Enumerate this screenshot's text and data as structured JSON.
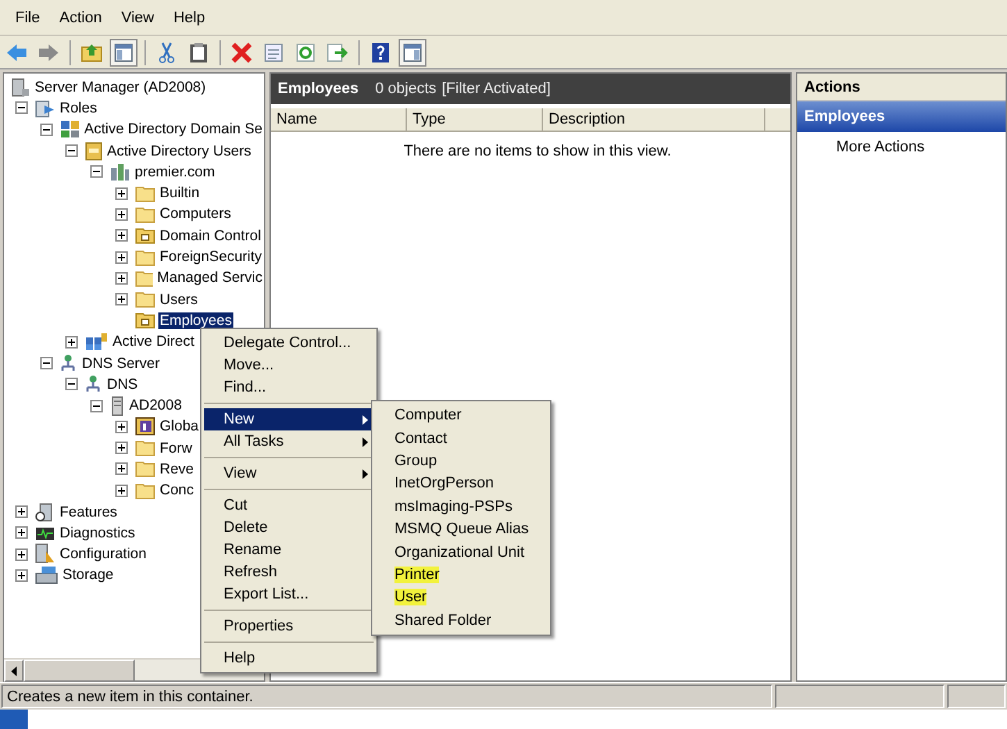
{
  "menu_bar": [
    "File",
    "Action",
    "View",
    "Help"
  ],
  "toolbar": [
    {
      "kind": "back"
    },
    {
      "kind": "forward"
    },
    {
      "kind": "sep"
    },
    {
      "kind": "up"
    },
    {
      "kind": "tree",
      "selected": true
    },
    {
      "kind": "sep"
    },
    {
      "kind": "cut"
    },
    {
      "kind": "paste"
    },
    {
      "kind": "sep"
    },
    {
      "kind": "delete"
    },
    {
      "kind": "properties"
    },
    {
      "kind": "refresh"
    },
    {
      "kind": "export"
    },
    {
      "kind": "sep"
    },
    {
      "kind": "help"
    },
    {
      "kind": "actionpane",
      "selected": true
    }
  ],
  "tree": [
    {
      "label": "Server Manager (AD2008)",
      "kind": "server",
      "selected": false,
      "children": [
        {
          "label": "Roles",
          "kind": "roles",
          "expanded": true,
          "selected": false,
          "children": [
            {
              "label": "Active Directory Domain Se",
              "kind": "ad",
              "expanded": true,
              "selected": false,
              "children": [
                {
                  "label": "Active Directory Users",
                  "kind": "book",
                  "expanded": true,
                  "selected": false,
                  "children": [
                    {
                      "label": "premier.com",
                      "kind": "domain",
                      "expanded": true,
                      "selected": false,
                      "children": [
                        {
                          "label": "Builtin",
                          "kind": "folder",
                          "expanded": false,
                          "selected": false
                        },
                        {
                          "label": "Computers",
                          "kind": "folder",
                          "expanded": false,
                          "selected": false
                        },
                        {
                          "label": "Domain Control",
                          "kind": "ou",
                          "expanded": false,
                          "selected": false
                        },
                        {
                          "label": "ForeignSecurity",
                          "kind": "folder",
                          "expanded": false,
                          "selected": false
                        },
                        {
                          "label": "Managed Servic",
                          "kind": "folder",
                          "expanded": false,
                          "selected": false
                        },
                        {
                          "label": "Users",
                          "kind": "folder",
                          "expanded": false,
                          "selected": false
                        },
                        {
                          "label": "Employees",
                          "kind": "ou",
                          "selected": true
                        }
                      ]
                    }
                  ]
                },
                {
                  "label": "Active Direct",
                  "kind": "sites",
                  "expanded": false,
                  "selected": false
                }
              ]
            },
            {
              "label": "DNS Server",
              "kind": "dns",
              "expanded": true,
              "selected": false,
              "children": [
                {
                  "label": "DNS",
                  "kind": "dns",
                  "expanded": true,
                  "selected": false,
                  "children": [
                    {
                      "label": "AD2008",
                      "kind": "computer",
                      "expanded": true,
                      "selected": false,
                      "children": [
                        {
                          "label": "Globa",
                          "kind": "log",
                          "expanded": false,
                          "selected": false
                        },
                        {
                          "label": "Forw",
                          "kind": "folder",
                          "expanded": false,
                          "selected": false
                        },
                        {
                          "label": "Reve",
                          "kind": "folder",
                          "expanded": false,
                          "selected": false
                        },
                        {
                          "label": "Conc",
                          "kind": "folder",
                          "expanded": false,
                          "selected": false
                        }
                      ]
                    }
                  ]
                }
              ]
            }
          ]
        },
        {
          "label": "Features",
          "kind": "features",
          "expanded": false,
          "selected": false
        },
        {
          "label": "Diagnostics",
          "kind": "diagnostics",
          "expanded": false,
          "selected": false
        },
        {
          "label": "Configuration",
          "kind": "config",
          "expanded": false,
          "selected": false
        },
        {
          "label": "Storage",
          "kind": "storage",
          "expanded": false,
          "selected": false
        }
      ]
    }
  ],
  "content": {
    "title": "Employees",
    "count": "0 objects",
    "filter": "[Filter Activated]",
    "columns": [
      "Name",
      "Type",
      "Description"
    ],
    "empty_message": "There are no items to show in this view."
  },
  "actions": {
    "title": "Actions",
    "section": "Employees",
    "items": [
      "More Actions"
    ]
  },
  "context_menu": [
    {
      "kind": "item",
      "label": "Delegate Control...",
      "selected": false
    },
    {
      "kind": "item",
      "label": "Move...",
      "selected": false
    },
    {
      "kind": "item",
      "label": "Find...",
      "selected": false
    },
    {
      "kind": "separator"
    },
    {
      "kind": "submenu",
      "label": "New",
      "selected": true
    },
    {
      "kind": "submenu",
      "label": "All Tasks",
      "selected": false
    },
    {
      "kind": "separator"
    },
    {
      "kind": "submenu",
      "label": "View",
      "selected": false
    },
    {
      "kind": "separator"
    },
    {
      "kind": "item",
      "label": "Cut",
      "selected": false
    },
    {
      "kind": "item",
      "label": "Delete",
      "selected": false
    },
    {
      "kind": "item",
      "label": "Rename",
      "selected": false
    },
    {
      "kind": "item",
      "label": "Refresh",
      "selected": false
    },
    {
      "kind": "item",
      "label": "Export List...",
      "selected": false
    },
    {
      "kind": "separator"
    },
    {
      "kind": "item",
      "label": "Properties",
      "selected": false
    },
    {
      "kind": "separator"
    },
    {
      "kind": "item",
      "label": "Help",
      "selected": false
    }
  ],
  "submenu": [
    {
      "label": "Computer",
      "highlighted": false
    },
    {
      "label": "Contact",
      "highlighted": false
    },
    {
      "label": "Group",
      "highlighted": false
    },
    {
      "label": "InetOrgPerson",
      "highlighted": false
    },
    {
      "label": "msImaging-PSPs",
      "highlighted": false
    },
    {
      "label": "MSMQ Queue Alias",
      "highlighted": false
    },
    {
      "label": "Organizational Unit",
      "highlighted": false
    },
    {
      "label": "Printer",
      "highlighted": true
    },
    {
      "label": "User",
      "highlighted": true
    },
    {
      "label": "Shared Folder",
      "highlighted": false
    }
  ],
  "status_bar": "Creates a new item in this container."
}
